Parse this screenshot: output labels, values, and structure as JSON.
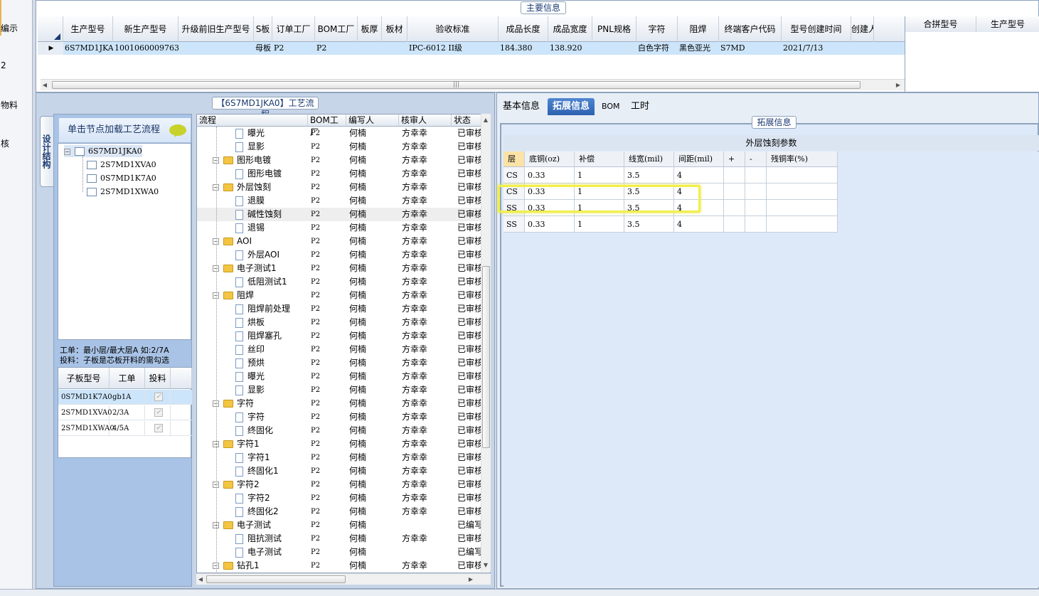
{
  "left_nav": {
    "items": [
      "编示",
      "",
      "2",
      "物料",
      "",
      "核"
    ]
  },
  "main_info": {
    "title": "主要信息",
    "columns": [
      "生产型号",
      "新生产型号",
      "升级前旧生产型号",
      "S板",
      "订单工厂",
      "BOM工厂",
      "板厚",
      "板材",
      "验收标准",
      "成品长度",
      "成品宽度",
      "PNL规格",
      "字符",
      "阻焊",
      "终端客户代码",
      "型号创建时间",
      "创建人"
    ],
    "row": [
      "6S7MD1JKA0",
      "10010600097631",
      "",
      "母板",
      "P2",
      "P2",
      "",
      "",
      "IPC-6012 II级",
      "184.380",
      "138.920",
      "",
      "白色字符",
      "黑色亚光",
      "S7MD",
      "2021/7/13",
      ""
    ],
    "side_columns": [
      "合拼型号",
      "生产型号"
    ]
  },
  "left_panel": {
    "vertical_tab": "设计结构",
    "load_button": "单击节点加载工艺流程",
    "tree": {
      "root": "6S7MD1JKA0",
      "children": [
        "2S7MD1XVA0",
        "0S7MD1K7A0",
        "2S7MD1XWA0"
      ]
    },
    "note_line1": "工单：最小层/最大层A 如:2/7A",
    "note_line2": "投料：子板是芯板开料的需勾选",
    "subgrid": {
      "headers": [
        "子板型号",
        "工单",
        "投料"
      ],
      "rows": [
        {
          "model": "0S7MD1K7A0",
          "order": "gb1A",
          "checked": true
        },
        {
          "model": "2S7MD1XVA0",
          "order": "2/3A",
          "checked": true
        },
        {
          "model": "2S7MD1XWA0",
          "order": "4/5A",
          "checked": true
        }
      ]
    }
  },
  "process": {
    "title": "【6S7MD1JKA0】工艺流程",
    "headers": [
      "流程",
      "BOM工厂",
      "编写人",
      "核审人",
      "状态"
    ],
    "rows": [
      {
        "name": "曝光",
        "type": "doc",
        "bom": "P2",
        "writer": "何楠",
        "checker": "方幸幸",
        "status": "已审核"
      },
      {
        "name": "显影",
        "type": "doc",
        "bom": "P2",
        "writer": "何楠",
        "checker": "方幸幸",
        "status": "已审核"
      },
      {
        "name": "图形电镀",
        "type": "folder",
        "bom": "P2",
        "writer": "何楠",
        "checker": "方幸幸",
        "status": "已审核"
      },
      {
        "name": "图形电镀",
        "type": "doc",
        "bom": "P2",
        "writer": "何楠",
        "checker": "方幸幸",
        "status": "已审核"
      },
      {
        "name": "外层蚀刻",
        "type": "folder",
        "bom": "P2",
        "writer": "何楠",
        "checker": "方幸幸",
        "status": "已审核"
      },
      {
        "name": "退膜",
        "type": "doc",
        "bom": "P2",
        "writer": "何楠",
        "checker": "方幸幸",
        "status": "已审核"
      },
      {
        "name": "碱性蚀刻",
        "type": "doc",
        "bom": "P2",
        "writer": "何楠",
        "checker": "方幸幸",
        "status": "已审核"
      },
      {
        "name": "退锡",
        "type": "doc",
        "bom": "P2",
        "writer": "何楠",
        "checker": "方幸幸",
        "status": "已审核"
      },
      {
        "name": "AOI",
        "type": "folder",
        "bom": "P2",
        "writer": "何楠",
        "checker": "方幸幸",
        "status": "已审核"
      },
      {
        "name": "外层AOI",
        "type": "doc",
        "bom": "P2",
        "writer": "何楠",
        "checker": "方幸幸",
        "status": "已审核"
      },
      {
        "name": "电子测试1",
        "type": "folder",
        "bom": "P2",
        "writer": "何楠",
        "checker": "方幸幸",
        "status": "已审核"
      },
      {
        "name": "低阻测试1",
        "type": "doc",
        "bom": "P2",
        "writer": "何楠",
        "checker": "方幸幸",
        "status": "已审核"
      },
      {
        "name": "阻焊",
        "type": "folder",
        "bom": "P2",
        "writer": "何楠",
        "checker": "方幸幸",
        "status": "已审核"
      },
      {
        "name": "阻焊前处理",
        "type": "doc",
        "bom": "P2",
        "writer": "何楠",
        "checker": "方幸幸",
        "status": "已审核"
      },
      {
        "name": "烘板",
        "type": "doc",
        "bom": "P2",
        "writer": "何楠",
        "checker": "方幸幸",
        "status": "已审核"
      },
      {
        "name": "阻焊塞孔",
        "type": "doc",
        "bom": "P2",
        "writer": "何楠",
        "checker": "方幸幸",
        "status": "已审核"
      },
      {
        "name": "丝印",
        "type": "doc",
        "bom": "P2",
        "writer": "何楠",
        "checker": "方幸幸",
        "status": "已审核"
      },
      {
        "name": "预烘",
        "type": "doc",
        "bom": "P2",
        "writer": "何楠",
        "checker": "方幸幸",
        "status": "已审核"
      },
      {
        "name": "曝光",
        "type": "doc",
        "bom": "P2",
        "writer": "何楠",
        "checker": "方幸幸",
        "status": "已审核"
      },
      {
        "name": "显影",
        "type": "doc",
        "bom": "P2",
        "writer": "何楠",
        "checker": "方幸幸",
        "status": "已审核"
      },
      {
        "name": "字符",
        "type": "folder",
        "bom": "P2",
        "writer": "何楠",
        "checker": "方幸幸",
        "status": "已审核"
      },
      {
        "name": "字符",
        "type": "doc",
        "bom": "P2",
        "writer": "何楠",
        "checker": "方幸幸",
        "status": "已审核"
      },
      {
        "name": "终固化",
        "type": "doc",
        "bom": "P2",
        "writer": "何楠",
        "checker": "方幸幸",
        "status": "已审核"
      },
      {
        "name": "字符1",
        "type": "folder",
        "bom": "P2",
        "writer": "何楠",
        "checker": "方幸幸",
        "status": "已审核"
      },
      {
        "name": "字符1",
        "type": "doc",
        "bom": "P2",
        "writer": "何楠",
        "checker": "方幸幸",
        "status": "已审核"
      },
      {
        "name": "终固化1",
        "type": "doc",
        "bom": "P2",
        "writer": "何楠",
        "checker": "方幸幸",
        "status": "已审核"
      },
      {
        "name": "字符2",
        "type": "folder",
        "bom": "P2",
        "writer": "何楠",
        "checker": "方幸幸",
        "status": "已审核"
      },
      {
        "name": "字符2",
        "type": "doc",
        "bom": "P2",
        "writer": "何楠",
        "checker": "方幸幸",
        "status": "已审核"
      },
      {
        "name": "终固化2",
        "type": "doc",
        "bom": "P2",
        "writer": "何楠",
        "checker": "方幸幸",
        "status": "已审核"
      },
      {
        "name": "电子测试",
        "type": "folder",
        "bom": "P2",
        "writer": "何楠",
        "checker": "",
        "status": "已编写"
      },
      {
        "name": "阻抗测试",
        "type": "doc",
        "bom": "P2",
        "writer": "何楠",
        "checker": "方幸幸",
        "status": "已审核"
      },
      {
        "name": "电子测试",
        "type": "doc",
        "bom": "P2",
        "writer": "何楠",
        "checker": "",
        "status": "已编写"
      },
      {
        "name": "钻孔1",
        "type": "folder",
        "bom": "P2",
        "writer": "何楠",
        "checker": "方幸幸",
        "status": "已审核"
      }
    ]
  },
  "right_panel": {
    "tabs": [
      "基本信息",
      "拓展信息",
      "BOM",
      "工时"
    ],
    "active_tab": 1,
    "section_title": "拓展信息",
    "table_caption": "外层蚀刻参数",
    "headers": [
      "层",
      "底铜(oz)",
      "补偿",
      "线宽(mil)",
      "间距(mil)",
      "+",
      "-",
      "残铜率(%)"
    ],
    "rows": [
      [
        "CS",
        "0.33",
        "1",
        "3.5",
        "4",
        "",
        "",
        ""
      ],
      [
        "CS",
        "0.33",
        "1",
        "3.5",
        "4",
        "",
        "",
        ""
      ],
      [
        "SS",
        "0.33",
        "1",
        "3.5",
        "4",
        "",
        "",
        ""
      ],
      [
        "SS",
        "0.33",
        "1",
        "3.5",
        "4",
        "",
        "",
        ""
      ]
    ],
    "accent_color": "#2d61b0",
    "highlight_color": "#f1ef4a"
  }
}
